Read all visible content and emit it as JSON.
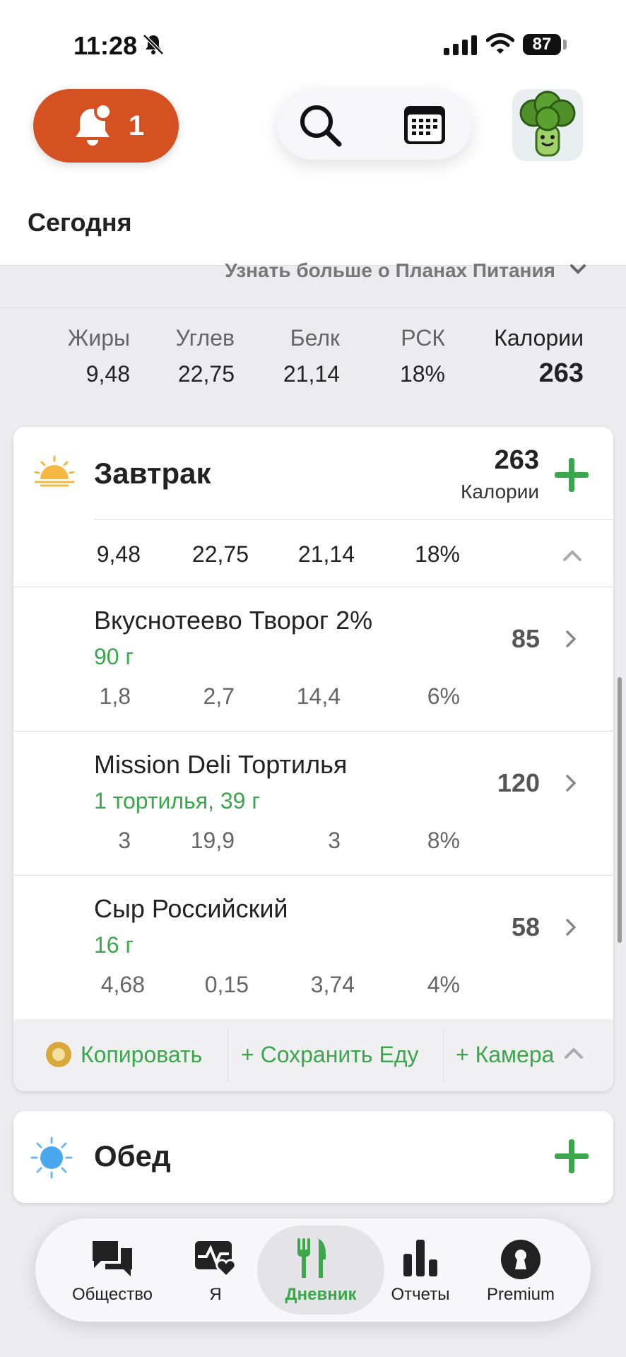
{
  "status_bar": {
    "time": "11:28",
    "battery": "87"
  },
  "header": {
    "notification_count": "1",
    "title": "Сегодня"
  },
  "learn_more": {
    "label": "Узнать больше о Планах Питания"
  },
  "totals": {
    "labels": [
      "Жиры",
      "Углев",
      "Белк",
      "РСК",
      "Калории"
    ],
    "values": [
      "9,48",
      "22,75",
      "21,14",
      "18%",
      "263"
    ]
  },
  "breakfast": {
    "title": "Завтрак",
    "calories": "263",
    "calories_label": "Калории",
    "macros": [
      "9,48",
      "22,75",
      "21,14",
      "18%"
    ],
    "items": [
      {
        "name": "Вкуснотеево Творог 2%",
        "portion": "90 г",
        "macros": [
          "1,8",
          "2,7",
          "14,4",
          "6%"
        ],
        "calories": "85"
      },
      {
        "name": "Mission Deli Тортилья",
        "portion": "1 тортилья, 39 г",
        "macros": [
          "3",
          "19,9",
          "3",
          "8%"
        ],
        "calories": "120"
      },
      {
        "name": "Сыр Российский",
        "portion": "16 г",
        "macros": [
          "4,68",
          "0,15",
          "3,74",
          "4%"
        ],
        "calories": "58"
      }
    ],
    "actions": {
      "copy": "Копировать",
      "save": "+ Сохранить Еду",
      "camera": "+ Камера"
    }
  },
  "lunch": {
    "title": "Обед"
  },
  "tabbar": {
    "items": [
      {
        "label": "Общество",
        "icon": "chat-bubbles-icon"
      },
      {
        "label": "Я",
        "icon": "heart-pulse-icon"
      },
      {
        "label": "Дневник",
        "icon": "fork-knife-icon"
      },
      {
        "label": "Отчеты",
        "icon": "bar-chart-icon"
      },
      {
        "label": "Premium",
        "icon": "keyhole-icon"
      }
    ]
  },
  "colors": {
    "accent": "#3aa84a",
    "notification": "#d55122"
  }
}
